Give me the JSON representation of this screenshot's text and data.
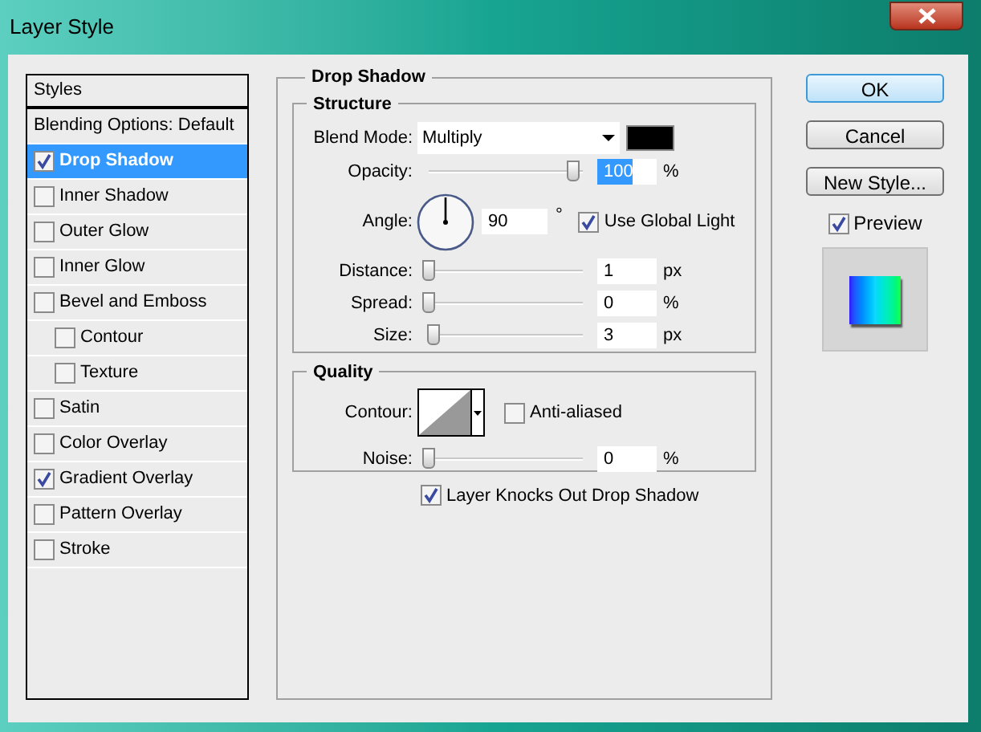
{
  "window": {
    "title": "Layer Style"
  },
  "styles_list": {
    "header": "Styles",
    "items": [
      {
        "label": "Blending Options: Default",
        "kind": "plain",
        "selected": false
      },
      {
        "label": "Drop Shadow",
        "kind": "effect",
        "checked": true,
        "selected": true
      },
      {
        "label": "Inner Shadow",
        "kind": "effect",
        "checked": false,
        "selected": false
      },
      {
        "label": "Outer Glow",
        "kind": "effect",
        "checked": false,
        "selected": false
      },
      {
        "label": "Inner Glow",
        "kind": "effect",
        "checked": false,
        "selected": false
      },
      {
        "label": "Bevel and Emboss",
        "kind": "effect",
        "checked": false,
        "selected": false,
        "children": [
          {
            "label": "Contour",
            "kind": "effect",
            "checked": false,
            "selected": false
          },
          {
            "label": "Texture",
            "kind": "effect",
            "checked": false,
            "selected": false
          }
        ]
      },
      {
        "label": "Satin",
        "kind": "effect",
        "checked": false,
        "selected": false
      },
      {
        "label": "Color Overlay",
        "kind": "effect",
        "checked": false,
        "selected": false
      },
      {
        "label": "Gradient Overlay",
        "kind": "effect",
        "checked": true,
        "selected": false
      },
      {
        "label": "Pattern Overlay",
        "kind": "effect",
        "checked": false,
        "selected": false
      },
      {
        "label": "Stroke",
        "kind": "effect",
        "checked": false,
        "selected": false
      }
    ]
  },
  "drop_shadow": {
    "title": "Drop Shadow",
    "structure": {
      "title": "Structure",
      "blend_mode": {
        "label": "Blend Mode:",
        "value": "Multiply"
      },
      "opacity": {
        "label": "Opacity:",
        "level": 1.0,
        "value": "100",
        "unit": "%",
        "highlighted": true
      },
      "angle": {
        "label": "Angle:",
        "value": "90",
        "unit": "°",
        "use_global_light": {
          "label": "Use Global Light",
          "checked": true
        }
      },
      "distance": {
        "label": "Distance:",
        "level": 0.0,
        "value": "1",
        "unit": "px"
      },
      "spread": {
        "label": "Spread:",
        "level": 0.0,
        "value": "0",
        "unit": "%"
      },
      "size": {
        "label": "Size:",
        "level": 0.03,
        "value": "3",
        "unit": "px"
      }
    },
    "quality": {
      "title": "Quality",
      "contour": {
        "label": "Contour:"
      },
      "anti_aliased": {
        "label": "Anti-aliased",
        "checked": false
      },
      "noise": {
        "label": "Noise:",
        "level": 0.0,
        "value": "0",
        "unit": "%"
      }
    },
    "layer_knocks_out": {
      "label": "Layer Knocks Out Drop Shadow",
      "checked": true
    }
  },
  "buttons": [
    {
      "label": "OK",
      "default": true
    },
    {
      "label": "Cancel",
      "default": false
    },
    {
      "label": "New Style...",
      "default": false
    }
  ],
  "preview": {
    "label": "Preview",
    "checked": true
  }
}
